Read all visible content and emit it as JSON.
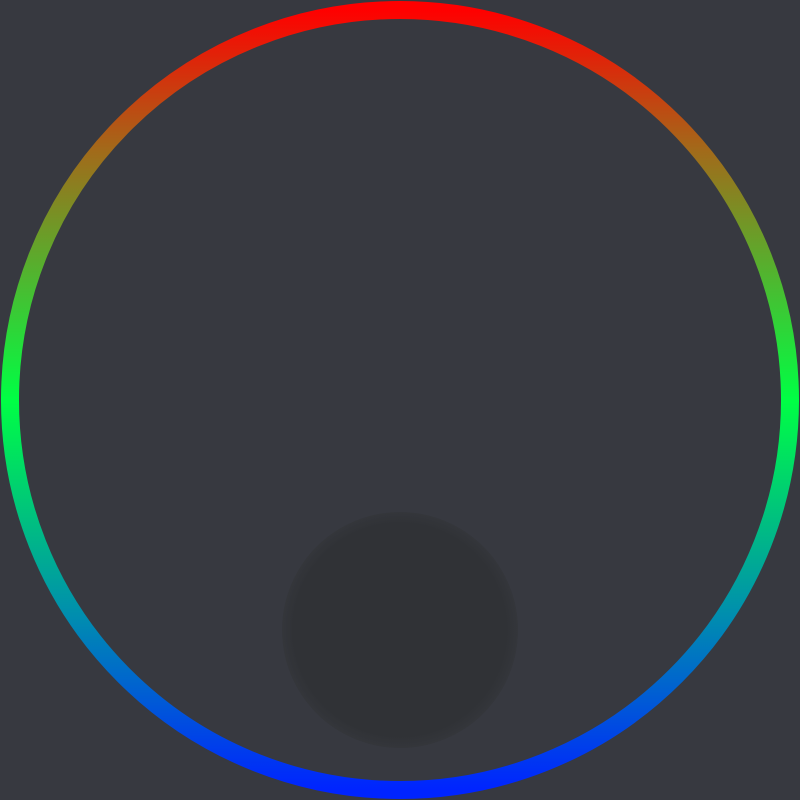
{
  "colors": {
    "background": "#373940",
    "ring_top": "#ff0000",
    "ring_upper": "#a26a1a",
    "ring_middle": "#00ff44",
    "ring_lower": "#008cb0",
    "ring_bottom": "#0024ff",
    "knob": "#303236"
  },
  "elements": {
    "ring": {
      "icon": "gradient-ring"
    },
    "knob": {
      "icon": "circle-knob"
    }
  }
}
